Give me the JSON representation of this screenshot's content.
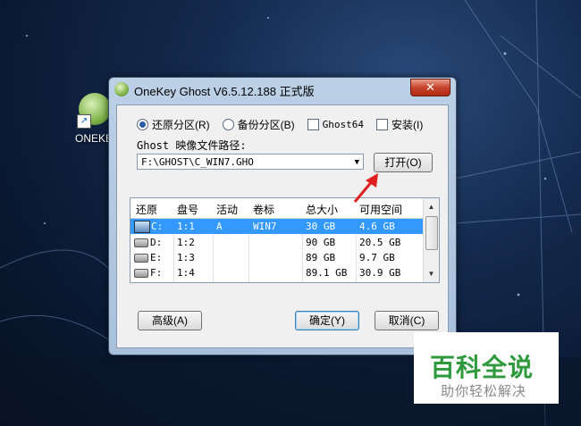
{
  "desktop": {
    "icon_label": "ONEKE"
  },
  "window": {
    "title": "OneKey Ghost V6.5.12.188 正式版",
    "close_glyph": "✕"
  },
  "options": {
    "restore": "还原分区(R)",
    "backup": "备份分区(B)",
    "ghost64": "Ghost64",
    "install": "安装(I)",
    "selected": "restore"
  },
  "image_path": {
    "label": "Ghost 映像文件路径:",
    "value": "F:\\GHOST\\C_WIN7.GHO",
    "open_button": "打开(O)"
  },
  "table": {
    "headers": [
      "还原",
      "盘号",
      "活动",
      "卷标",
      "总大小",
      "可用空间"
    ],
    "rows": [
      {
        "drive": "C:",
        "num": "1:1",
        "active": "A",
        "label": "WIN7",
        "total": "30 GB",
        "free": "4.6 GB",
        "selected": true
      },
      {
        "drive": "D:",
        "num": "1:2",
        "active": "",
        "label": "",
        "total": "90 GB",
        "free": "20.5 GB",
        "selected": false
      },
      {
        "drive": "E:",
        "num": "1:3",
        "active": "",
        "label": "",
        "total": "89 GB",
        "free": "9.7 GB",
        "selected": false
      },
      {
        "drive": "F:",
        "num": "1:4",
        "active": "",
        "label": "",
        "total": "89.1 GB",
        "free": "30.9 GB",
        "selected": false
      }
    ]
  },
  "buttons": {
    "advanced": "高级(A)",
    "ok": "确定(Y)",
    "cancel": "取消(C)"
  },
  "watermark": {
    "title": "百科全说",
    "subtitle": "助你轻松解决"
  },
  "colors": {
    "selection": "#3399ff",
    "arrow": "#e02020",
    "watermark_green": "#2e9a3c"
  }
}
